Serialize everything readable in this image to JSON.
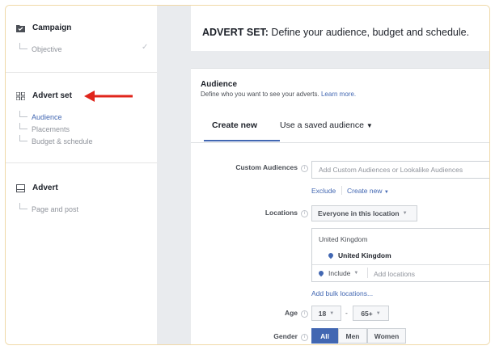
{
  "sidebar": {
    "campaign": {
      "title": "Campaign",
      "items": [
        "Objective"
      ]
    },
    "advert_set": {
      "title": "Advert set",
      "items": [
        "Audience",
        "Placements",
        "Budget & schedule"
      ]
    },
    "advert": {
      "title": "Advert",
      "items": [
        "Page and post"
      ]
    }
  },
  "header": {
    "prefix": "ADVERT SET:",
    "text": " Define your audience, budget and schedule."
  },
  "audience": {
    "title": "Audience",
    "subtitle": "Define who you want to see your adverts.",
    "learn_more": "Learn more.",
    "tabs": [
      "Create new",
      "Use a saved audience"
    ],
    "custom_audiences": {
      "label": "Custom Audiences",
      "placeholder": "Add Custom Audiences or Lookalike Audiences",
      "exclude": "Exclude",
      "create_new": "Create new"
    },
    "locations": {
      "label": "Locations",
      "dropdown": "Everyone in this location",
      "region": "United Kingdom",
      "selected": "United Kingdom",
      "include": "Include",
      "placeholder": "Add locations",
      "bulk": "Add bulk locations..."
    },
    "age": {
      "label": "Age",
      "min": "18",
      "separator": "-",
      "max": "65+"
    },
    "gender": {
      "label": "Gender",
      "options": [
        "All",
        "Men",
        "Women"
      ],
      "selected": "All"
    }
  },
  "colors": {
    "accent": "#4267b2",
    "arrow": "#e0251b"
  }
}
